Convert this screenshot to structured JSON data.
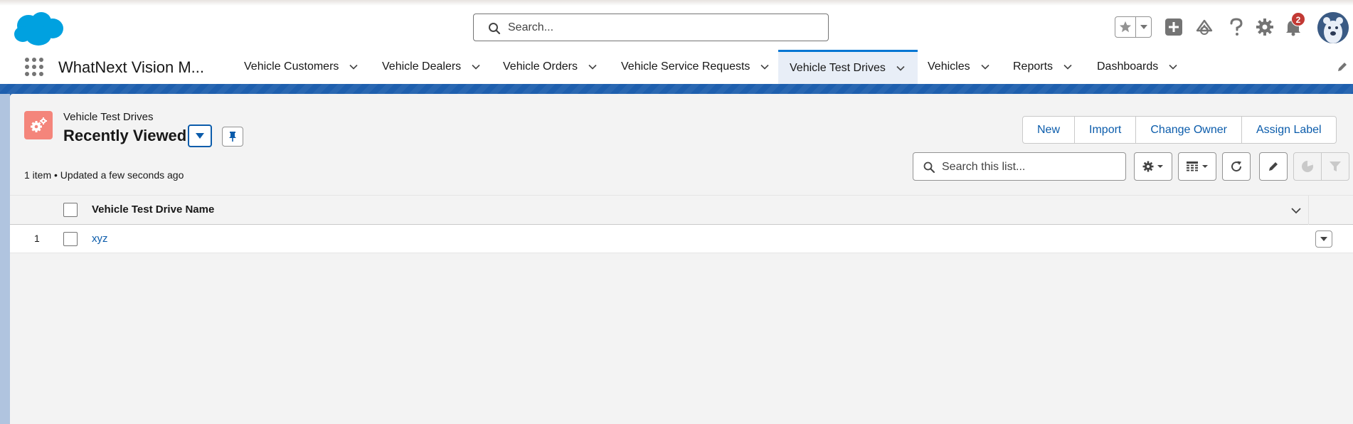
{
  "header": {
    "search_placeholder": "Search...",
    "notification_count": "2"
  },
  "nav": {
    "app_name": "WhatNext Vision M...",
    "items": [
      {
        "label": "Vehicle Customers"
      },
      {
        "label": "Vehicle Dealers"
      },
      {
        "label": "Vehicle Orders"
      },
      {
        "label": "Vehicle Service Requests"
      },
      {
        "label": "Vehicle Test Drives",
        "active": true
      },
      {
        "label": "Vehicles"
      },
      {
        "label": "Reports"
      },
      {
        "label": "Dashboards"
      }
    ]
  },
  "list_view": {
    "object_label": "Vehicle Test Drives",
    "view_name": "Recently Viewed",
    "meta": "1 item • Updated a few seconds ago",
    "buttons": [
      "New",
      "Import",
      "Change Owner",
      "Assign Label"
    ],
    "search_placeholder": "Search this list...",
    "columns": [
      "Vehicle Test Drive Name"
    ],
    "rows": [
      {
        "num": "1",
        "name": "xyz"
      }
    ]
  },
  "colors": {
    "brand_blue": "#0176d3",
    "link_blue": "#0b5cab",
    "object_icon": "#f4857b",
    "band_blue": "#1e5fae",
    "badge_red": "#c23934"
  },
  "icons": [
    "salesforce-cloud-logo",
    "search-icon",
    "star-icon",
    "plus-icon",
    "trailhead-icon",
    "help-icon",
    "gear-icon",
    "bell-icon",
    "avatar",
    "waffle-icon",
    "chevron-down-icon",
    "pencil-icon",
    "pin-icon",
    "refresh-icon",
    "table-icon",
    "chart-icon",
    "filter-icon"
  ]
}
